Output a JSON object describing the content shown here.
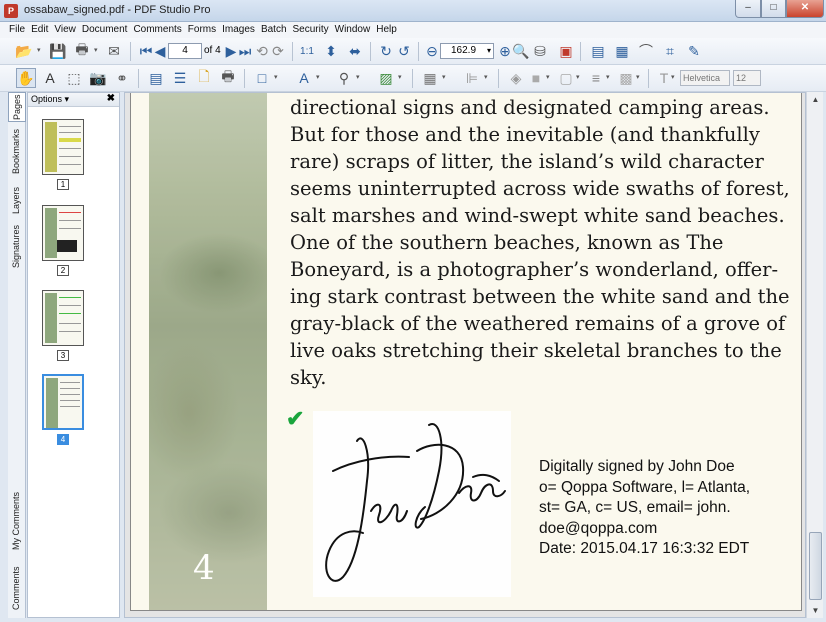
{
  "window": {
    "title": "ossabaw_signed.pdf - PDF Studio Pro",
    "minimize": "–",
    "maximize": "□",
    "close": "✕"
  },
  "menu": [
    "File",
    "Edit",
    "View",
    "Document",
    "Comments",
    "Forms",
    "Images",
    "Batch",
    "Security",
    "Window",
    "Help"
  ],
  "toolbar": {
    "page_current": "4",
    "page_total": "of 4",
    "zoom": "162.9",
    "font_name": "Helvetica",
    "font_size": "12"
  },
  "side_tabs": [
    "Pages",
    "Bookmarks",
    "Layers",
    "Signatures",
    "My Comments",
    "Comments"
  ],
  "panel": {
    "options_label": "Options ▾",
    "close": "✖",
    "thumbnails": [
      "1",
      "2",
      "3",
      "4"
    ],
    "selected_page": "4"
  },
  "document": {
    "page_number": "4",
    "lines": [
      "directional signs and designated camping areas.",
      "But for those and the inevitable (and thankfully",
      "rare) scraps of litter, the island’s wild character",
      "seems uninterrupted across wide swaths of forest,",
      "salt marshes and wind-swept white sand beaches.",
      "One of the southern beaches, known as The",
      "Boneyard, is a photographer’s wonderland, offer-",
      "ing stark contrast between the white sand and the",
      "gray-black of the weathered remains of a grove of",
      "live oaks stretching their skeletal branches to the",
      "sky."
    ],
    "signature": {
      "check": "✔",
      "info": [
        "Digitally signed by John Doe",
        "o= Qoppa Software, l= Atlanta,",
        "st= GA, c= US, email= john.",
        "doe@qoppa.com",
        "Date: 2015.04.17 16:3:32 EDT"
      ]
    }
  },
  "colors": {
    "page_bg": "#fbf9ee",
    "check": "#1aa53c",
    "selection": "#3a8de0"
  }
}
